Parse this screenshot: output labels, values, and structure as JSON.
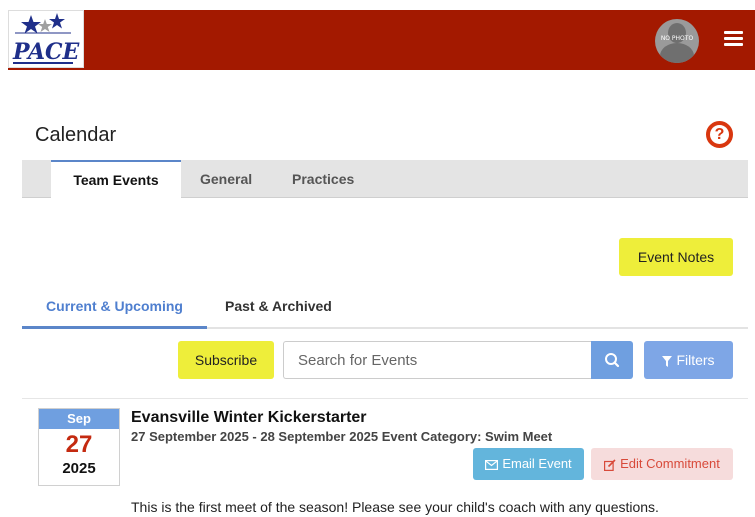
{
  "header": {
    "logo_text": "PACE",
    "avatar_text": "NO PHOTO",
    "colors": {
      "bar": "#a31900"
    }
  },
  "page": {
    "title": "Calendar",
    "help_icon": "question-circle-icon"
  },
  "main_tabs": [
    {
      "label": "Team Events",
      "active": true
    },
    {
      "label": "General",
      "active": false
    },
    {
      "label": "Practices",
      "active": false
    }
  ],
  "actions": {
    "event_notes_label": "Event Notes",
    "subscribe_label": "Subscribe",
    "filters_label": "Filters"
  },
  "sub_tabs": [
    {
      "label": "Current & Upcoming",
      "active": true
    },
    {
      "label": "Past & Archived",
      "active": false
    }
  ],
  "search": {
    "placeholder": "Search for Events",
    "value": ""
  },
  "events": [
    {
      "month": "Sep",
      "day": "27",
      "year": "2025",
      "title": "Evansville Winter Kickerstarter",
      "dates_category": "27 September 2025 - 28 September 2025 Event Category: Swim Meet",
      "email_label": "Email Event",
      "edit_label": "Edit Commitment",
      "description": "This is the first meet of the season! Please see your child's coach with any questions."
    }
  ],
  "colors": {
    "accent_blue": "#6f9fe0",
    "yellow": "#eeee3a",
    "date_red": "#c42a10",
    "help_orange": "#d9370f"
  }
}
